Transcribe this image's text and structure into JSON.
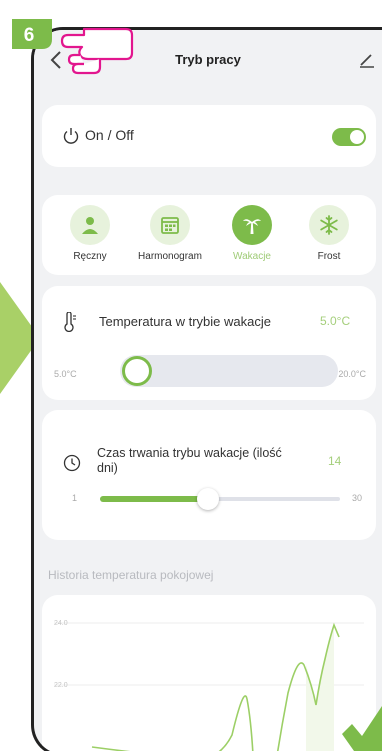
{
  "step": {
    "number": "6",
    "color": "#7dbb4a"
  },
  "header": {
    "title": "Tryb pracy",
    "back_icon": "chevron-left-icon",
    "edit_icon": "pencil-icon"
  },
  "power": {
    "label": "On / Off",
    "icon": "power-icon",
    "enabled": true
  },
  "modes": {
    "items": [
      {
        "label": "Ręczny",
        "icon": "person-icon",
        "active": false
      },
      {
        "label": "Harmonogram",
        "icon": "calendar-icon",
        "active": false
      },
      {
        "label": "Wakacje",
        "icon": "palm-tree-icon",
        "active": true
      },
      {
        "label": "Frost",
        "icon": "snowflake-icon",
        "active": false
      }
    ]
  },
  "temperature": {
    "label": "Temperatura w trybie wakacje",
    "value": "5.0°C",
    "min_label": "5.0°C",
    "max_label": "20.0°C",
    "icon": "thermometer-icon",
    "level": 0
  },
  "duration": {
    "label": "Czas trwania trybu wakacje (ilość dni)",
    "value": "14",
    "min_label": "1",
    "max_label": "30",
    "icon": "clock-icon",
    "level": 0.45
  },
  "history": {
    "title": "Historia temperatura pokojowej",
    "y_labels": [
      "24.0",
      "22.0"
    ]
  },
  "colors": {
    "accent": "#7dbb4a",
    "accent_light": "#e7f2dc",
    "annotation": "#e2168e",
    "background": "#f1f2f4"
  }
}
